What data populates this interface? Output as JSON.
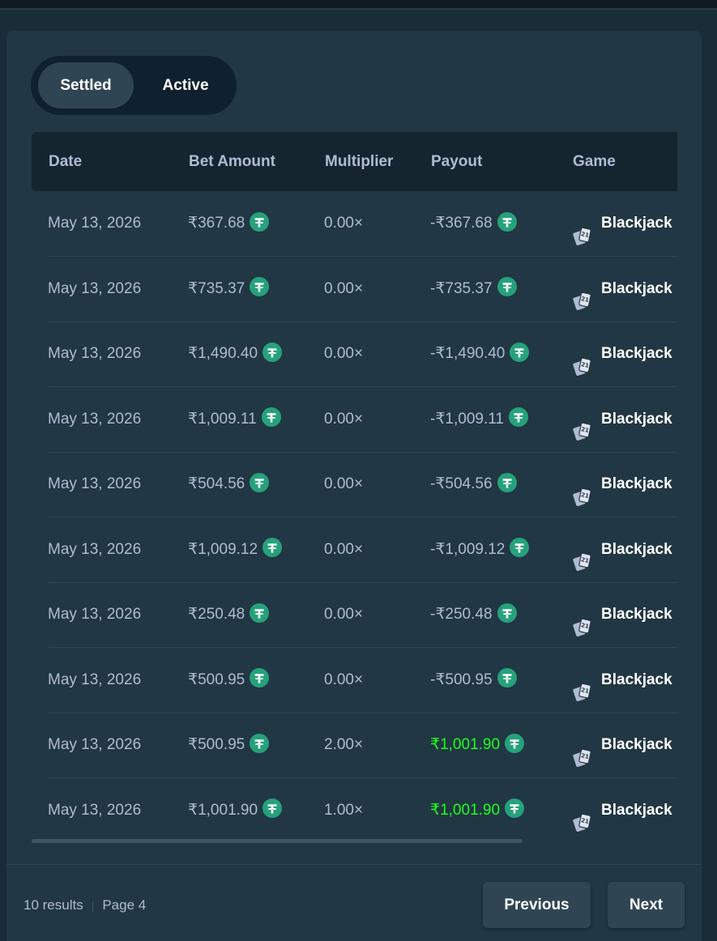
{
  "tabs": {
    "settled": "Settled",
    "active": "Active"
  },
  "columns": {
    "date": "Date",
    "bet_amount": "Bet Amount",
    "multiplier": "Multiplier",
    "payout": "Payout",
    "game": "Game"
  },
  "currency_icon": "usdt-icon",
  "game_icon": "blackjack-cards-icon",
  "colors": {
    "win": "#1fff20",
    "text_muted": "#b1bad3",
    "coin": "#26a17b"
  },
  "rows": [
    {
      "date": "May 13, 2026",
      "bet": "₹367.68",
      "multiplier": "0.00×",
      "payout": "-₹367.68",
      "win": false,
      "game": "Blackjack"
    },
    {
      "date": "May 13, 2026",
      "bet": "₹735.37",
      "multiplier": "0.00×",
      "payout": "-₹735.37",
      "win": false,
      "game": "Blackjack"
    },
    {
      "date": "May 13, 2026",
      "bet": "₹1,490.40",
      "multiplier": "0.00×",
      "payout": "-₹1,490.40",
      "win": false,
      "game": "Blackjack"
    },
    {
      "date": "May 13, 2026",
      "bet": "₹1,009.11",
      "multiplier": "0.00×",
      "payout": "-₹1,009.11",
      "win": false,
      "game": "Blackjack"
    },
    {
      "date": "May 13, 2026",
      "bet": "₹504.56",
      "multiplier": "0.00×",
      "payout": "-₹504.56",
      "win": false,
      "game": "Blackjack"
    },
    {
      "date": "May 13, 2026",
      "bet": "₹1,009.12",
      "multiplier": "0.00×",
      "payout": "-₹1,009.12",
      "win": false,
      "game": "Blackjack"
    },
    {
      "date": "May 13, 2026",
      "bet": "₹250.48",
      "multiplier": "0.00×",
      "payout": "-₹250.48",
      "win": false,
      "game": "Blackjack"
    },
    {
      "date": "May 13, 2026",
      "bet": "₹500.95",
      "multiplier": "0.00×",
      "payout": "-₹500.95",
      "win": false,
      "game": "Blackjack"
    },
    {
      "date": "May 13, 2026",
      "bet": "₹500.95",
      "multiplier": "2.00×",
      "payout": "₹1,001.90",
      "win": true,
      "game": "Blackjack"
    },
    {
      "date": "May 13, 2026",
      "bet": "₹1,001.90",
      "multiplier": "1.00×",
      "payout": "₹1,001.90",
      "win": true,
      "game": "Blackjack"
    }
  ],
  "footer": {
    "results": "10 results",
    "page": "Page 4"
  },
  "pagination": {
    "previous": "Previous",
    "next": "Next"
  }
}
